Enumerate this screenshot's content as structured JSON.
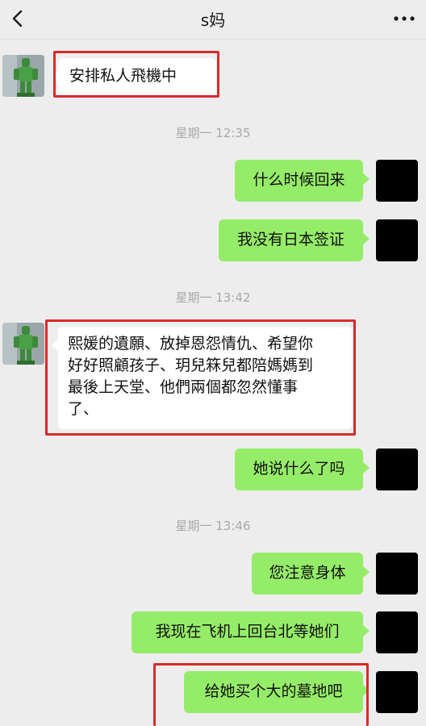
{
  "header": {
    "title": "s妈",
    "back_icon": "chevron-left-icon",
    "more_icon": "more-dots-icon"
  },
  "messages": [
    {
      "from": "contact",
      "text": "安排私人飛機中",
      "highlighted": true
    },
    {
      "type": "time",
      "text": "星期一 12:35"
    },
    {
      "from": "me",
      "text": "什么时候回来"
    },
    {
      "from": "me",
      "text": "我没有日本签证"
    },
    {
      "type": "time",
      "text": "星期一 13:42"
    },
    {
      "from": "contact",
      "lines": [
        "熙媛的遺願、放掉恩怨情仇、希望你",
        "好好照顧孩子、玥兒箖兒都陪媽媽到",
        "最後上天堂、他們兩個都忽然懂事",
        "了、"
      ],
      "highlighted": true
    },
    {
      "from": "me",
      "text": "她说什么了吗"
    },
    {
      "type": "time",
      "text": "星期一 13:46"
    },
    {
      "from": "me",
      "text": "您注意身体"
    },
    {
      "from": "me",
      "text": "我现在飞机上回台北等她们"
    },
    {
      "from": "me",
      "text": "给她买个大的墓地吧",
      "highlighted": true
    }
  ],
  "colors": {
    "background": "#ededed",
    "outgoing_bubble": "#95ec69",
    "incoming_bubble": "#ffffff",
    "highlight": "#d92a2a",
    "timestamp": "#a8a8a8"
  }
}
